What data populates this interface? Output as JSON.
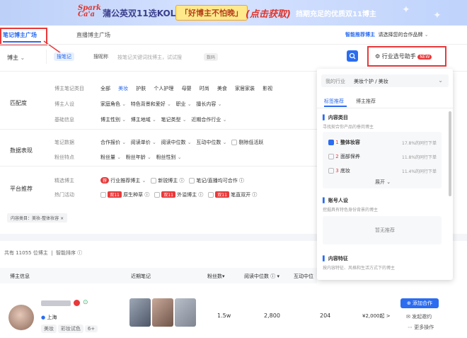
{
  "banner": {
    "logo_line1": "Spark",
    "logo_line2": "Ca'a",
    "title": "蒲公英双11选KOL攻略",
    "highlight": "「好博主不怕晚」",
    "cta": "(点击获取)",
    "tail": "挡期充足的优质双11博主"
  },
  "tabs": {
    "active": "笔记博主广场",
    "other": "直播博主广场"
  },
  "smart": {
    "label": "智能推荐博主",
    "text": "请选择您的合作品牌"
  },
  "search": {
    "filter": "博主",
    "tag1": "搜笔记",
    "tag2": "搜昵称",
    "placeholder": "按笔记关键词找博主，试试搜",
    "hint": "数码"
  },
  "assistant": {
    "label": "行业选号助手",
    "badge": "NEW"
  },
  "match": {
    "title": "匹配度",
    "rows": [
      {
        "label": "博主笔记类目",
        "items": [
          "全部",
          "美妆",
          "护肤",
          "个人护理",
          "母婴",
          "时尚",
          "美食",
          "家居家装",
          "影视"
        ]
      },
      {
        "label": "博主人设",
        "items": [
          "家庭角色",
          "特色背景和爱好",
          "职业",
          "擅长内容"
        ]
      },
      {
        "label": "基础信息",
        "items": [
          "博主性别",
          "博主地域",
          "笔记类型",
          "近期合作行业"
        ]
      }
    ]
  },
  "data": {
    "title": "数据表现",
    "rows": [
      {
        "label": "笔记数据",
        "items": [
          "合作报价",
          "阅读单价",
          "阅读中位数",
          "互动中位数",
          "剔除低活跃"
        ]
      },
      {
        "label": "粉丝特点",
        "items": [
          "粉丝量",
          "粉丝年龄",
          "粉丝性别"
        ]
      }
    ]
  },
  "platform": {
    "title": "平台推荐",
    "rows": [
      {
        "label": "精选博主",
        "items": [
          "行业推荐博主",
          "新锐博主",
          "笔记/直播均可合作"
        ]
      },
      {
        "label": "热门活动",
        "items": [
          "原生种草",
          "外溢博主",
          "笔直双开"
        ],
        "tag": "双11"
      }
    ]
  },
  "filter_tag": "内容类目：美妆-整体妆容 ×",
  "results": {
    "count": "共有 11055 位博主",
    "sort": "智能排序"
  },
  "table": {
    "headers": [
      "博主信息",
      "近期笔记",
      "粉丝数",
      "阅读中位数",
      "互动中位"
    ],
    "row": {
      "location": "上海",
      "tags": [
        "美妆",
        "彩妆试色",
        "6+"
      ],
      "fans": "1.5w",
      "reads": "2,800",
      "interact": "204",
      "price": "¥2,000起 >",
      "add": "添加合作",
      "invite": "发起邀约",
      "more": "更多操作"
    }
  },
  "panel": {
    "my_industry_label": "我的行业",
    "my_industry_value": "美妆个护 / 美妆",
    "tabs": [
      "标签推荐",
      "博主推荐"
    ],
    "sec1": {
      "title": "内容类目",
      "desc": "寻找契合你产品的垂岗博主",
      "items": [
        {
          "rank": "1",
          "name": "整体妆容",
          "stat": "17.8%的同行下单",
          "checked": true
        },
        {
          "rank": "2",
          "name": "面部保养",
          "stat": "11.8%的同行下单",
          "checked": false
        },
        {
          "rank": "3",
          "name": "底妆",
          "stat": "11.4%的同行下单",
          "checked": false
        }
      ],
      "expand": "展开"
    },
    "sec2": {
      "title": "账号人设",
      "desc": "挖掘具有特色身份背景的博主",
      "empty": "暂无推荐"
    },
    "sec3": {
      "title": "内容特征",
      "desc": "按内容特征、风格和生活方式下的博主"
    }
  },
  "colors": {
    "primary": "#2b6cf0",
    "highlight": "#e8393a"
  }
}
